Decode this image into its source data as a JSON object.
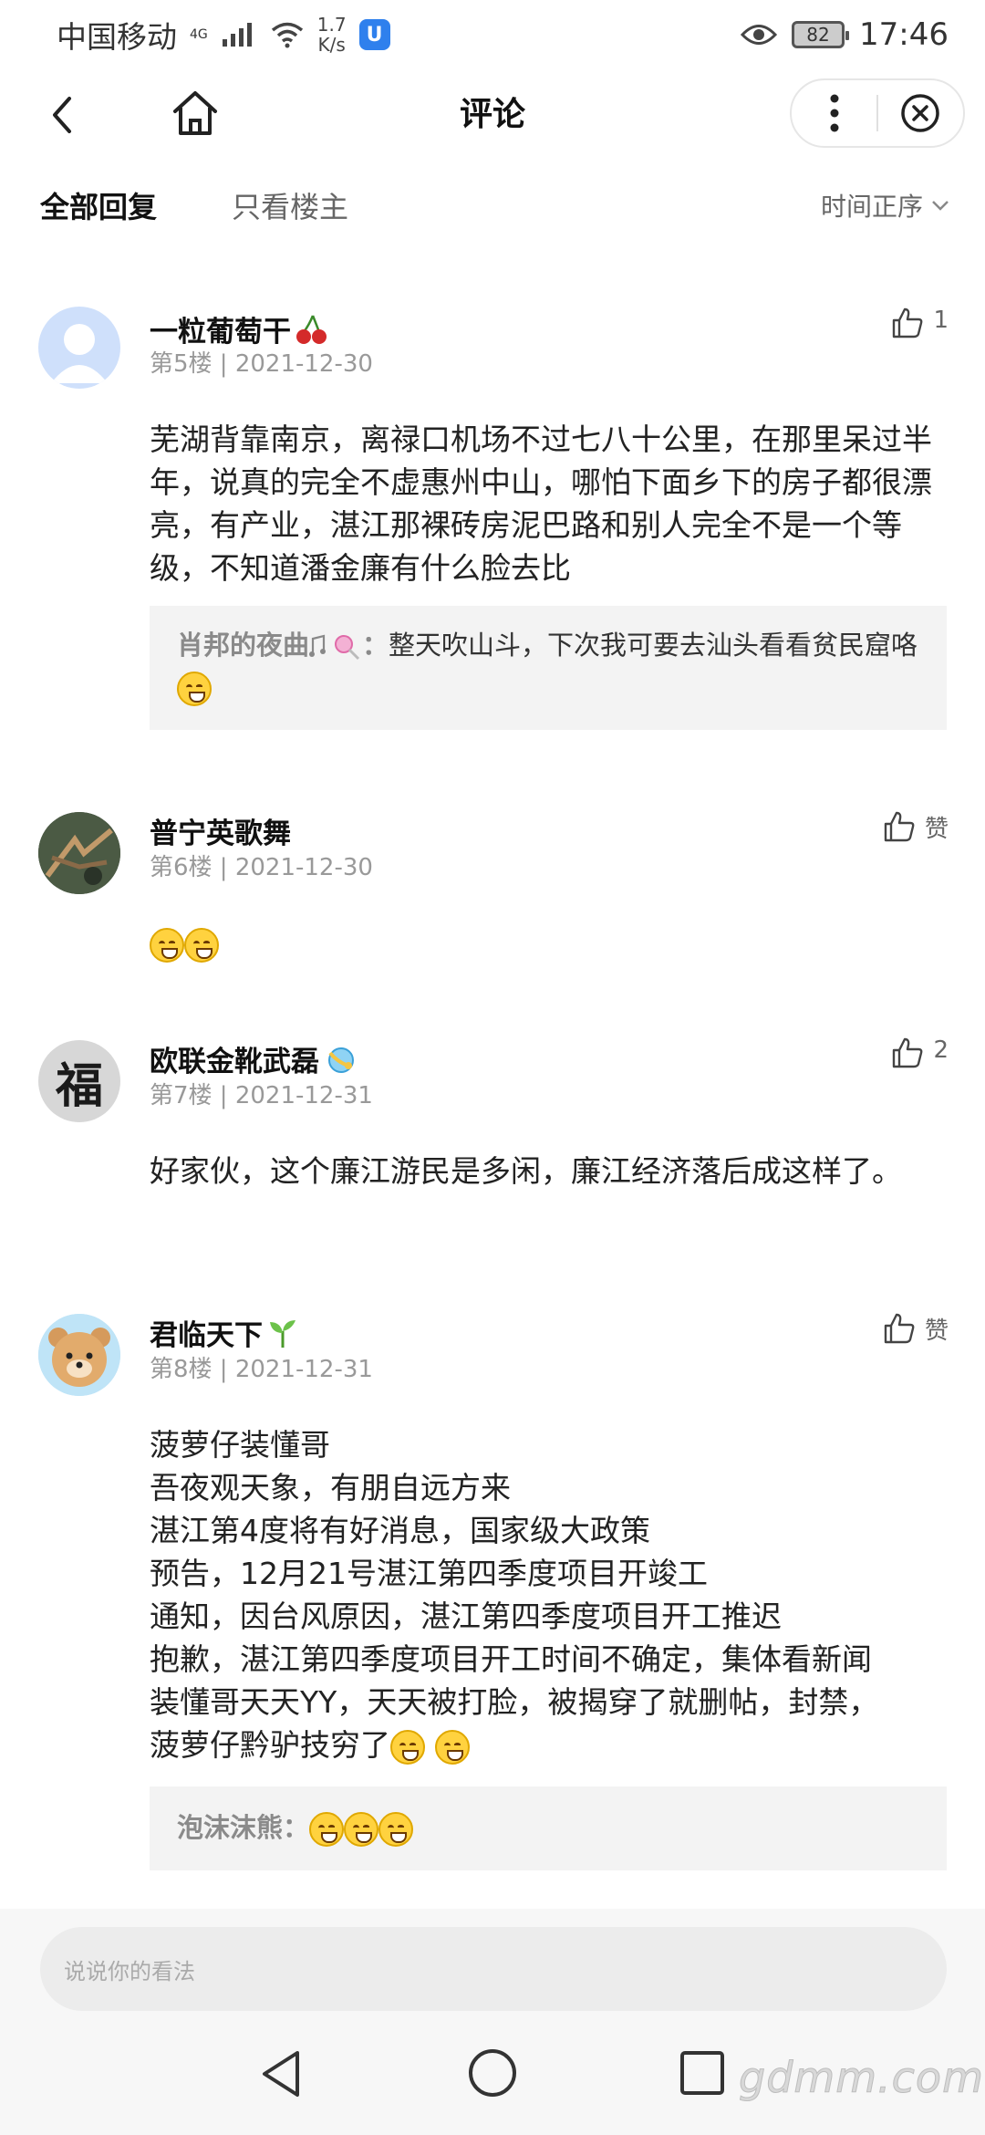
{
  "status_bar": {
    "carrier": "中国移动",
    "network": "4G",
    "speed_value": "1.7",
    "speed_unit": "K/s",
    "battery": "82",
    "time": "17:46"
  },
  "nav": {
    "title": "评论"
  },
  "tabs": {
    "all_replies": "全部回复",
    "op_only": "只看楼主",
    "sort": "时间正序"
  },
  "comments": [
    {
      "name": "一粒葡萄干",
      "floor": "第5楼",
      "date": "2021-12-30",
      "likes": "1",
      "text": "芜湖背靠南京，离禄口机场不过七八十公里，在那里呆过半年，说真的完全不虚惠州中山，哪怕下面乡下的房子都很漂亮，有产业，湛江那裸砖房泥巴路和别人完全不是一个等级，不知道潘金廉有什么脸去比",
      "reply_name": "肖邦的夜曲",
      "reply_text": "整天吹山斗，下次我可要去汕头看看贫民窟咯"
    },
    {
      "name": "普宁英歌舞",
      "floor": "第6楼",
      "date": "2021-12-30",
      "likes": "赞"
    },
    {
      "name": "欧联金靴武磊",
      "floor": "第7楼",
      "date": "2021-12-31",
      "likes": "2",
      "text": "好家伙，这个廉江游民是多闲，廉江经济落后成这样了。",
      "avatar_char": "福"
    },
    {
      "name": "君临天下",
      "floor": "第8楼",
      "date": "2021-12-31",
      "likes": "赞",
      "lines": [
        "菠萝仔装懂哥",
        "吾夜观天象，有朋自远方来",
        "湛江第4度将有好消息，国家级大政策",
        "预告，12月21号湛江第四季度项目开竣工",
        "通知，因台风原因，湛江第四季度项目开工推迟",
        "抱歉，湛江第四季度项目开工时间不确定，集体看新闻",
        "装懂哥天天YY，天天被打脸，被揭穿了就删帖，封禁，",
        "菠萝仔黔驴技穷了"
      ],
      "reply_name": "泡沫沫熊"
    }
  ],
  "input": {
    "placeholder": "说说你的看法"
  },
  "watermark": "gdmm.com"
}
